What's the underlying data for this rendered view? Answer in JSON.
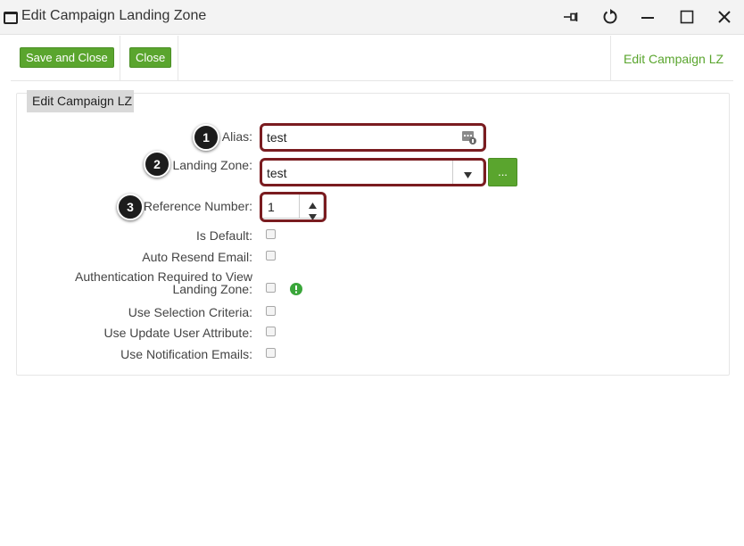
{
  "window": {
    "title": "Edit Campaign Landing Zone",
    "controls": [
      "pin",
      "refresh",
      "minimize",
      "maximize",
      "close"
    ]
  },
  "toolbar": {
    "save_close_label": "Save and Close",
    "close_label": "Close",
    "right_title": "Edit Campaign LZ"
  },
  "panel": {
    "tab_label": "Edit Campaign LZ"
  },
  "form": {
    "alias": {
      "label": "Alias:",
      "value": "test"
    },
    "landing_zone": {
      "label": "Landing Zone:",
      "value": "test",
      "browse_label": "..."
    },
    "reference_number": {
      "label": "Reference Number:",
      "value": "1"
    },
    "is_default": {
      "label": "Is Default:",
      "checked": false
    },
    "auto_resend": {
      "label": "Auto Resend Email:",
      "checked": false
    },
    "auth_required": {
      "label_line1": "Authentication Required to View",
      "label_line2": "Landing Zone:",
      "checked": false
    },
    "use_selection": {
      "label": "Use Selection Criteria:",
      "checked": false
    },
    "use_update_user": {
      "label": "Use Update User Attribute:",
      "checked": false
    },
    "use_notification": {
      "label": "Use Notification Emails:",
      "checked": false
    }
  },
  "callouts": [
    "1",
    "2",
    "3"
  ],
  "colors": {
    "accent_green": "#5aa52e",
    "highlight_border": "#7a1c20",
    "badge_bg": "#1c1c1c"
  }
}
